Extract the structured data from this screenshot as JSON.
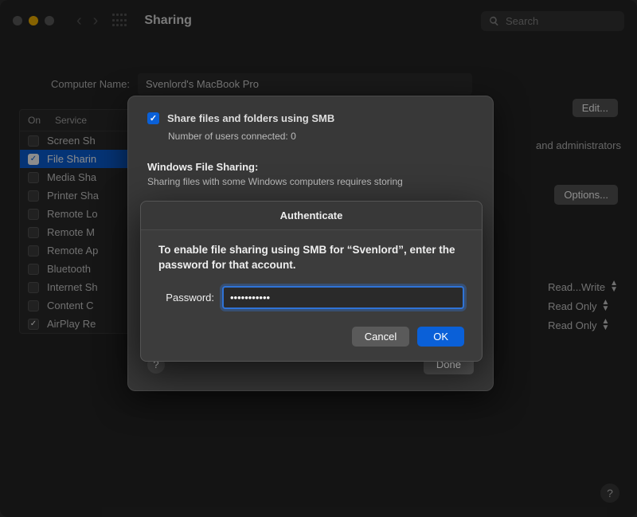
{
  "traffic": {
    "close": "#5b5b5b",
    "min": "#f5b301",
    "max": "#5b5b5b"
  },
  "title": "Sharing",
  "search": {
    "placeholder": "Search"
  },
  "computer_name": {
    "label": "Computer Name:",
    "value": "Svenlord's MacBook Pro"
  },
  "edit_label": "Edit...",
  "sidebar": {
    "head_on": "On",
    "head_service": "Service",
    "items": [
      {
        "label": "Screen Sh",
        "checked": false
      },
      {
        "label": "File Sharin",
        "checked": true,
        "selected": true
      },
      {
        "label": "Media Sha",
        "checked": false
      },
      {
        "label": "Printer Sha",
        "checked": false
      },
      {
        "label": "Remote Lo",
        "checked": false
      },
      {
        "label": "Remote M",
        "checked": false
      },
      {
        "label": "Remote Ap",
        "checked": false
      },
      {
        "label": "Bluetooth",
        "checked": false
      },
      {
        "label": "Internet Sh",
        "checked": false
      },
      {
        "label": "Content C",
        "checked": false
      },
      {
        "label": "AirPlay Re",
        "checked": true
      }
    ]
  },
  "main": {
    "desc_tail": "and administrators"
  },
  "options_label": "Options...",
  "perms": [
    {
      "label": "Read...Write"
    },
    {
      "label": "Read Only"
    },
    {
      "label": "Read Only"
    }
  ],
  "sheet": {
    "smb_label": "Share files and folders using SMB",
    "users_connected": "Number of users connected: 0",
    "wfs_title": "Windows File Sharing:",
    "wfs_desc": "Sharing files with some Windows computers requires storing",
    "done_label": "Done"
  },
  "auth": {
    "title": "Authenticate",
    "message": "To enable file sharing using SMB for “Svenlord”, enter the password for that account.",
    "password_label": "Password:",
    "password_value": "•••••••••••",
    "cancel_label": "Cancel",
    "ok_label": "OK"
  }
}
